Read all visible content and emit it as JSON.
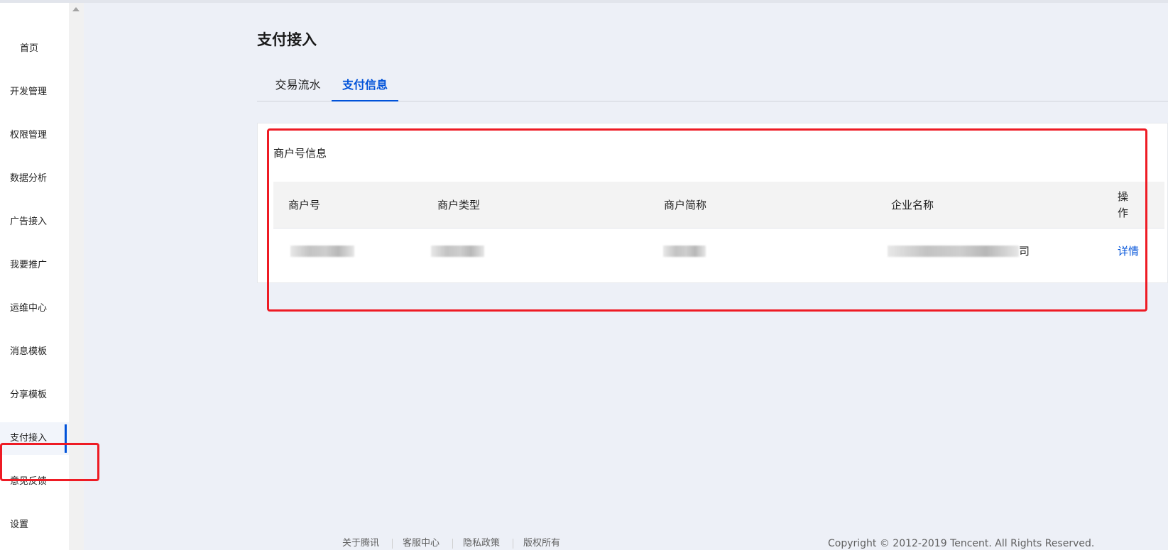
{
  "sidebar": {
    "items": [
      {
        "label": "首页"
      },
      {
        "label": "开发管理"
      },
      {
        "label": "权限管理"
      },
      {
        "label": "数据分析"
      },
      {
        "label": "广告接入"
      },
      {
        "label": "我要推广"
      },
      {
        "label": "运维中心"
      },
      {
        "label": "消息模板"
      },
      {
        "label": "分享模板"
      },
      {
        "label": "支付接入",
        "active": true
      },
      {
        "label": "意见反馈"
      },
      {
        "label": "设置"
      }
    ]
  },
  "main": {
    "title": "支付接入",
    "tabs": [
      {
        "label": "交易流水",
        "active": false
      },
      {
        "label": "支付信息",
        "active": true
      }
    ],
    "card": {
      "title": "商户号信息",
      "columns": [
        "商户号",
        "商户类型",
        "商户简称",
        "企业名称",
        "操作"
      ],
      "rows": [
        {
          "company_tail": "司",
          "action": "详情"
        }
      ]
    }
  },
  "footer": {
    "links": [
      "关于腾讯",
      "客服中心",
      "隐私政策",
      "版权所有"
    ],
    "copyright": "Copyright © 2012-2019 Tencent. All Rights Reserved."
  },
  "colors": {
    "accent": "#0052d9",
    "annotation": "#ee1b24",
    "background": "#edf0f7"
  }
}
